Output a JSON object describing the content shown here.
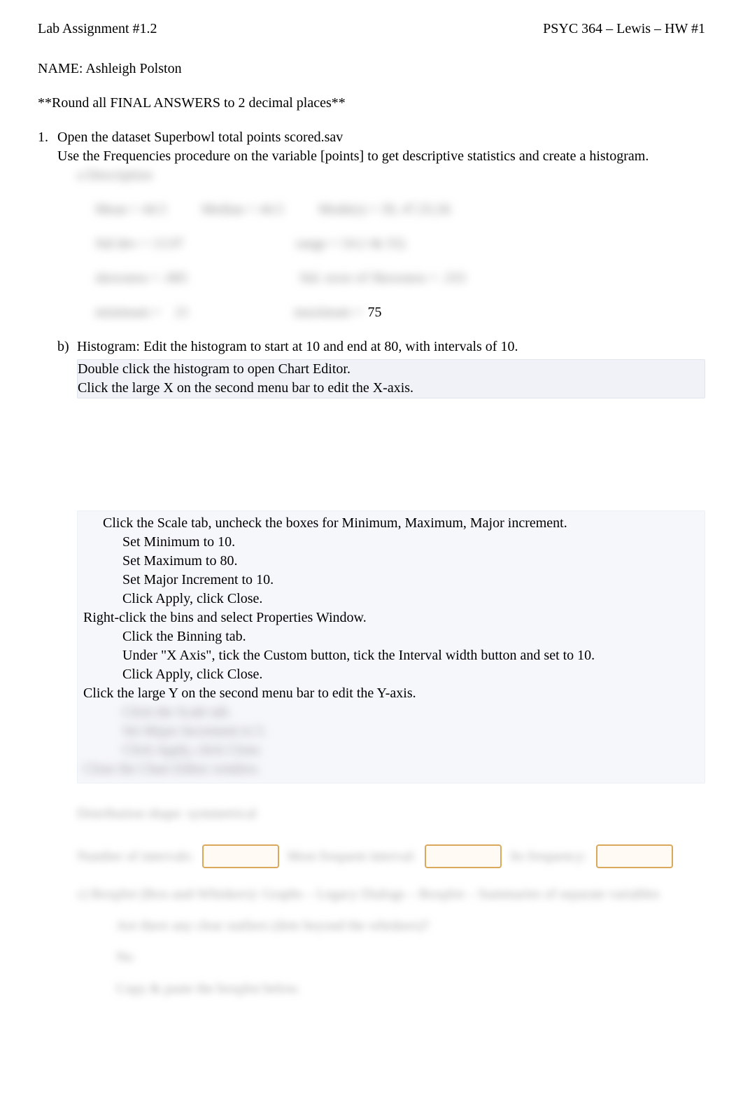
{
  "header": {
    "left": "Lab Assignment #1.2",
    "right": "PSYC 364 – Lewis – HW #1"
  },
  "name_line": "NAME: Ashleigh Polston",
  "round_note": "**Round all FINAL ANSWERS to 2 decimal places**",
  "q1": {
    "num": "1.",
    "line1_a": "Open the dataset ",
    "line1_b": "Superbowl total points scored.sav",
    "line2_a": "Use the ",
    "line2_b": "Frequencies",
    "line2_c": " procedure on the variable ",
    "line2_d": "[points]",
    "line2_e": " to get ",
    "line2_f": "descriptive statistics",
    "line2_g": " and create a ",
    "line2_h": "histogram",
    "line2_i": "."
  },
  "part_a_label": "a Description",
  "stats": {
    "visible_value": "75"
  },
  "part_b": {
    "label": "b)",
    "line1": "Histogram: Edit the histogram to start at 10 and end at 80, with intervals of 10.",
    "line2_a": "Double click the histogram to open ",
    "line2_b": "Chart Editor",
    "line2_c": ".",
    "line3": "Click the large X on the second menu bar to edit the X-axis."
  },
  "scale_block": {
    "l1_a": "Click the ",
    "l1_b": "Scale",
    "l1_c": " tab, uncheck the boxes for Minimum, Maximum, Major increment.",
    "l2_a": "Set Minimum to ",
    "l2_b": "10",
    "l2_c": ".",
    "l3_a": "Set Maximum to ",
    "l3_b": "80",
    "l3_c": ".",
    "l4_a": "Set Major Increment to ",
    "l4_b": "10",
    "l4_c": ".",
    "l5_a": "Click ",
    "l5_b": "Apply",
    "l5_c": ", click ",
    "l5_d": "Close",
    "l5_e": ".",
    "rc_a": "Right-click",
    "rc_b": " the bins and select ",
    "rc_c": "Properties Window",
    "rc_d": ".",
    "bin_a": "Click the ",
    "bin_b": "Binning",
    "bin_c": " tab.",
    "xa_a": "Under ",
    "xa_b": "\"X Axis\"",
    "xa_c": ", tick the ",
    "xa_d": "Custom",
    "xa_e": " button, tick the ",
    "xa_f": "Interval width",
    "xa_g": " button and set to 10.",
    "ac_a": "Click ",
    "ac_b": "Apply",
    "ac_c": ", click ",
    "ac_d": "Close",
    "ac_e": ".",
    "y_line": "Click the large Y on the second menu bar to edit the Y-axis."
  },
  "obscured_y": {
    "l1": "Click the Scale tab.",
    "l2": "Set Major Increment to 5.",
    "l3": "Click Apply, click Close.",
    "l4": "Close the Chart Editor window."
  },
  "dist_shape": "Distribution shape: symmetrical",
  "fill": {
    "label1": "Number of intervals:",
    "label2": "Most frequent interval:",
    "label3": "Its frequency:"
  },
  "boxplot_line": "c) Boxplot (Box-and-Whiskers): Graphs – Legacy Dialogs – Boxplot – Summaries of separate variables",
  "outlier_q": "Are there any clear outliers (dots beyond the whiskers)?",
  "outlier_a": "No",
  "copy_line": "Copy & paste the boxplot below."
}
